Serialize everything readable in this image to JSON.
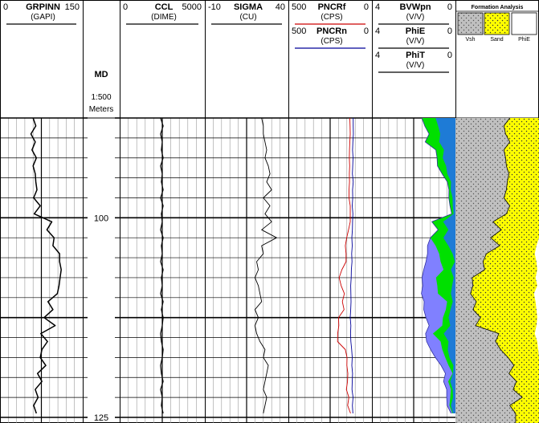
{
  "tracks": [
    {
      "header_lines": [
        {
          "name": "GRPINN",
          "left": "0",
          "right": "150",
          "unit": "(GAPI)",
          "color": "#000000"
        }
      ]
    },
    {
      "depth_header": {
        "title": "MD",
        "scale": "1:500",
        "units": "Meters"
      }
    },
    {
      "header_lines": [
        {
          "name": "CCL",
          "left": "0",
          "right": "5000",
          "unit": "(DIME)",
          "color": "#000000"
        }
      ]
    },
    {
      "header_lines": [
        {
          "name": "SIGMA",
          "left": "-10",
          "right": "40",
          "unit": "(CU)",
          "color": "#000000"
        }
      ]
    },
    {
      "header_lines": [
        {
          "name": "PNCRf",
          "left": "500",
          "right": "0",
          "unit": "(CPS)",
          "color": "#cc0000"
        },
        {
          "name": "PNCRn",
          "left": "500",
          "right": "0",
          "unit": "(CPS)",
          "color": "#000099"
        }
      ]
    },
    {
      "header_lines": [
        {
          "name": "BVWpn",
          "left": "4",
          "right": "0",
          "unit": "(V/V)",
          "color": "#000000"
        },
        {
          "name": "PhiE",
          "left": "4",
          "right": "0",
          "unit": "(V/V)",
          "color": "#000000"
        },
        {
          "name": "PhiT",
          "left": "4",
          "right": "0",
          "unit": "(V/V)",
          "color": "#000000"
        }
      ]
    },
    {
      "formation": {
        "title": "Formation Analysis",
        "labels": [
          "Vsh",
          "Sand",
          "PhiE"
        ],
        "colors": {
          "vsh": "#c0c0c0",
          "sand": "#ffff00",
          "phie": "#ffffff"
        }
      }
    }
  ],
  "depth_labels": [
    "100",
    "125"
  ],
  "chart_data": {
    "type": "line",
    "title": "",
    "depth_axis": {
      "label": "MD",
      "units": "Meters",
      "scale": "1:500",
      "range": [
        87.5,
        125
      ]
    },
    "depths": [
      87.5,
      88.5,
      89.5,
      90.5,
      91.5,
      92.5,
      93.5,
      94.5,
      95.5,
      96.5,
      97.5,
      98.5,
      99.5,
      100.5,
      101.5,
      102.5,
      103.5,
      104.5,
      105.5,
      106.5,
      107.5,
      108.5,
      109.5,
      110.5,
      111.5,
      112.5,
      113.5,
      114.5,
      115.5,
      116.5,
      117.5,
      118.5,
      119.5,
      120.5,
      121.5,
      122.5,
      123.5,
      124.5
    ],
    "series": [
      {
        "name": "GRPINN",
        "unit": "GAPI",
        "range": [
          0,
          150
        ],
        "values": [
          60,
          65,
          56,
          64,
          58,
          66,
          60,
          64,
          65,
          67,
          61,
          73,
          62,
          94,
          85,
          98,
          96,
          108,
          108,
          111,
          109,
          107,
          104,
          87,
          96,
          80,
          100,
          74,
          86,
          76,
          73,
          83,
          68,
          76,
          64,
          69,
          61,
          66
        ]
      },
      {
        "name": "CCL",
        "unit": "DIME",
        "range": [
          0,
          5000
        ],
        "values": [
          2400,
          2550,
          2400,
          2500,
          2450,
          2550,
          2400,
          2500,
          2450,
          2550,
          2400,
          2550,
          2450,
          2500,
          2400,
          2550,
          2450,
          2500,
          2400,
          2550,
          2450,
          2500,
          2400,
          2550,
          2450,
          2550,
          2500,
          2400,
          2450,
          2550,
          2500,
          2400,
          2450,
          2550,
          2400,
          2500,
          2450,
          2550
        ]
      },
      {
        "name": "SIGMA",
        "unit": "CU",
        "range": [
          -10,
          40
        ],
        "values": [
          24,
          25,
          25,
          26,
          27,
          26,
          28,
          29,
          27,
          30,
          25,
          29,
          26,
          30,
          24,
          33,
          24,
          25,
          21,
          22,
          20,
          22,
          23,
          24,
          20,
          22,
          20,
          21,
          23,
          26,
          25,
          28,
          27,
          26,
          25,
          27,
          26,
          25
        ]
      },
      {
        "name": "PNCRf",
        "unit": "CPS",
        "range": [
          500,
          0
        ],
        "values": [
          132,
          131,
          130,
          132,
          134,
          135,
          133,
          135,
          134,
          137,
          137,
          130,
          130,
          130,
          140,
          151,
          159,
          155,
          155,
          180,
          196,
          184,
          165,
          177,
          167,
          200,
          198,
          205,
          206,
          159,
          149,
          150,
          144,
          146,
          153,
          138,
          145,
          128
        ]
      },
      {
        "name": "PNCRn",
        "unit": "CPS",
        "range": [
          500,
          0
        ],
        "values": [
          112,
          112,
          111,
          114,
          116,
          113,
          115,
          117,
          112,
          116,
          115,
          118,
          114,
          116,
          117,
          120,
          118,
          121,
          119,
          123,
          124,
          127,
          126,
          125,
          127,
          130,
          126,
          128,
          126,
          121,
          118,
          120,
          116,
          118,
          119,
          113,
          117,
          114
        ]
      },
      {
        "name": "BVWpn",
        "unit": "V/V",
        "range": [
          4,
          0
        ],
        "values": [
          0.95,
          0.83,
          0.73,
          0.78,
          0.55,
          0.61,
          0.45,
          0.39,
          0.21,
          0.23,
          0.14,
          0.13,
          0.09,
          0.59,
          0.34,
          0.58,
          0.34,
          0.14,
          0.03,
          0.22,
          0.09,
          0.16,
          0.22,
          0.13,
          0.24,
          0.33,
          0.25,
          0.56,
          0.33,
          0.37,
          0.29,
          0.1,
          0.12,
          0.25,
          0.13,
          0.12,
          0.22,
          0.12
        ]
      },
      {
        "name": "PhiE",
        "unit": "V/V",
        "range": [
          4,
          0
        ],
        "values": [
          1.61,
          1.47,
          1.26,
          1.45,
          0.94,
          0.88,
          0.86,
          0.64,
          0.39,
          0.31,
          0.32,
          0.26,
          0.18,
          1.13,
          0.83,
          1.2,
          0.95,
          0.78,
          0.71,
          0.57,
          0.93,
          0.87,
          0.84,
          0.4,
          0.46,
          0.6,
          0.63,
          1.08,
          0.71,
          0.63,
          0.49,
          0.33,
          0.14,
          0.35,
          0.22,
          0.25,
          0.29,
          0.15
        ]
      },
      {
        "name": "PhiT",
        "unit": "V/V",
        "range": [
          4,
          0
        ],
        "values": [
          1.61,
          1.47,
          1.26,
          1.45,
          0.94,
          0.88,
          0.86,
          0.64,
          0.39,
          0.31,
          0.32,
          0.26,
          0.18,
          1.13,
          0.83,
          1.2,
          1.34,
          1.34,
          1.41,
          1.52,
          1.6,
          1.57,
          1.63,
          1.5,
          1.52,
          1.41,
          1.26,
          1.43,
          1.38,
          1.19,
          0.96,
          0.69,
          0.48,
          0.57,
          0.42,
          0.42,
          0.4,
          0.21
        ]
      },
      {
        "name": "Vsh",
        "unit": "V/V",
        "range": [
          0,
          1
        ],
        "values": [
          0.65,
          0.58,
          0.6,
          0.65,
          0.58,
          0.6,
          0.61,
          0.64,
          0.62,
          0.61,
          0.58,
          0.65,
          0.61,
          0.45,
          0.55,
          0.42,
          0.53,
          0.37,
          0.33,
          0.35,
          0.2,
          0.21,
          0.18,
          0.25,
          0.21,
          0.3,
          0.24,
          0.52,
          0.48,
          0.54,
          0.63,
          0.7,
          0.64,
          0.73,
          0.69,
          0.8,
          0.65,
          0.72
        ]
      },
      {
        "name": "PhiE_frac",
        "unit": "V/V",
        "range": [
          0,
          1
        ],
        "values": [
          0.0,
          0.0,
          0.0,
          0.0,
          0.0,
          0.0,
          0.0,
          0.0,
          0.0,
          0.0,
          0.0,
          0.0,
          0.0,
          0.0,
          0.0,
          0.0,
          0.03,
          0.05,
          0.03,
          0.02,
          0.04,
          0.02,
          0.06,
          0.04,
          0.03,
          0.02,
          0.03,
          0.05,
          0.02,
          0.01,
          0.0,
          0.0,
          0.0,
          0.0,
          0.0,
          0.0,
          0.0,
          0.0
        ]
      }
    ]
  }
}
